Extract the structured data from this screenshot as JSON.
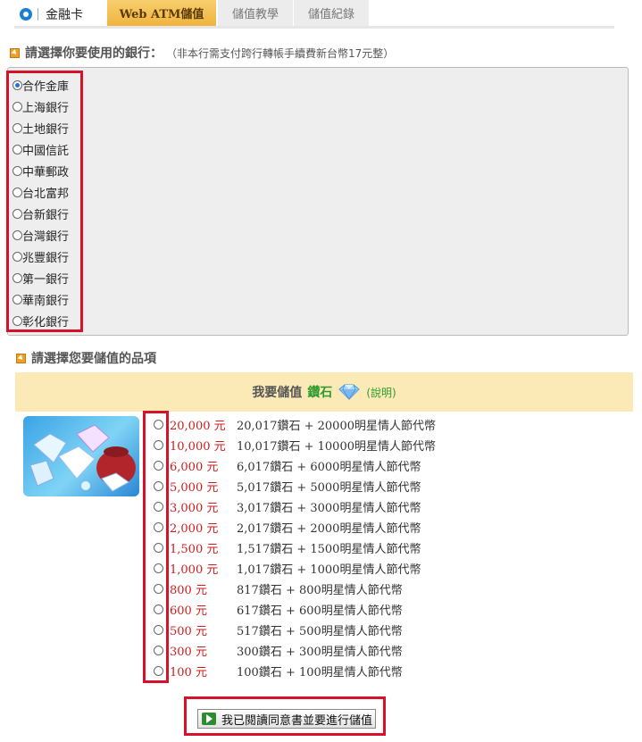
{
  "tabs": {
    "first_label": "金融卡",
    "active_label": "Web ATM儲值",
    "tutorial_label": "儲值教學",
    "records_label": "儲值紀錄"
  },
  "bank_section": {
    "title": "請選擇你要使用的銀行：",
    "note": "（非本行需支付跨行轉帳手續費新台幣17元整）",
    "banks": [
      {
        "label": "合作金庫",
        "selected": true
      },
      {
        "label": "上海銀行",
        "selected": false
      },
      {
        "label": "土地銀行",
        "selected": false
      },
      {
        "label": "中國信託",
        "selected": false
      },
      {
        "label": "中華郵政",
        "selected": false
      },
      {
        "label": "台北富邦",
        "selected": false
      },
      {
        "label": "台新銀行",
        "selected": false
      },
      {
        "label": "台灣銀行",
        "selected": false
      },
      {
        "label": "兆豐銀行",
        "selected": false
      },
      {
        "label": "第一銀行",
        "selected": false
      },
      {
        "label": "華南銀行",
        "selected": false
      },
      {
        "label": "彰化銀行",
        "selected": false
      }
    ]
  },
  "product_section": {
    "title": "請選擇您要儲值的品項",
    "header_prefix": "我要儲值",
    "header_item": "鑽石",
    "help_label": "(說明)",
    "items": [
      {
        "price": "20,000 元",
        "desc": "20,017鑽石 + 20000明星情人節代幣"
      },
      {
        "price": "10,000 元",
        "desc": "10,017鑽石 + 10000明星情人節代幣"
      },
      {
        "price": "6,000 元",
        "desc": "6,017鑽石 + 6000明星情人節代幣"
      },
      {
        "price": "5,000 元",
        "desc": "5,017鑽石 + 5000明星情人節代幣"
      },
      {
        "price": "3,000 元",
        "desc": "3,017鑽石 + 3000明星情人節代幣"
      },
      {
        "price": "2,000 元",
        "desc": "2,017鑽石 + 2000明星情人節代幣"
      },
      {
        "price": "1,500 元",
        "desc": "1,517鑽石 + 1500明星情人節代幣"
      },
      {
        "price": "1,000 元",
        "desc": "1,017鑽石 + 1000明星情人節代幣"
      },
      {
        "price": "800 元",
        "desc": "817鑽石 + 800明星情人節代幣"
      },
      {
        "price": "600 元",
        "desc": "617鑽石 + 600明星情人節代幣"
      },
      {
        "price": "500 元",
        "desc": "517鑽石 + 500明星情人節代幣"
      },
      {
        "price": "300 元",
        "desc": "300鑽石 + 300明星情人節代幣"
      },
      {
        "price": "100 元",
        "desc": "100鑽石 + 100明星情人節代幣"
      }
    ]
  },
  "submit": {
    "label": "我已閱讀同意書並要進行儲值"
  },
  "colors": {
    "accent_red": "#d21c1c",
    "highlight_frame": "#d8112a",
    "active_tab": "#f0b43f",
    "product_header": "#fbe9b6"
  }
}
